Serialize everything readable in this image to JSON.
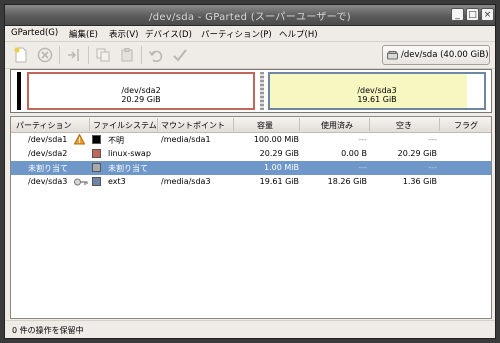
{
  "window": {
    "title": "/dev/sda - GParted (スーパーユーザーで)"
  },
  "menu": [
    "GParted(G)",
    "編集(E)",
    "表示(V)",
    "デバイス(D)",
    "パーティション(P)",
    "ヘルプ(H)"
  ],
  "toolbar": {
    "buttons": [
      "new-icon",
      "delete-icon",
      "resize-move-icon",
      "copy-icon",
      "paste-icon",
      "undo-icon",
      "apply-icon"
    ],
    "device_label": "/dev/sda  (40.00 GiB)"
  },
  "map": {
    "partitions": [
      {
        "name": "",
        "size": "",
        "color": "#000000"
      },
      {
        "name": "/dev/sda2",
        "size": "20.29 GiB",
        "color": "#c1665a"
      },
      {
        "name": "",
        "size": "",
        "color": "#a9a9a9"
      },
      {
        "name": "/dev/sda3",
        "size": "19.61 GiB",
        "color": "#6e86a5",
        "fill": "#f7f7c2"
      }
    ]
  },
  "table": {
    "headers": [
      "パーティション",
      "ファイルシステム",
      "マウントポイント",
      "容量",
      "使用済み",
      "空き",
      "フラグ"
    ],
    "rows": [
      {
        "partition": "/dev/sda1",
        "warn": true,
        "fs_color": "#000000",
        "fs": "不明",
        "mount": "/media/sda1",
        "size": "100.00 MiB",
        "used": "---",
        "free": "---",
        "flags": ""
      },
      {
        "partition": "/dev/sda2",
        "warn": false,
        "fs_color": "#c1665a",
        "fs": "linux-swap",
        "mount": "",
        "size": "20.29 GiB",
        "used": "0.00 B",
        "free": "20.29 GiB",
        "flags": ""
      },
      {
        "partition": "未割り当て",
        "warn": false,
        "fs_color": "#a9a9a9",
        "fs": "未割り当て",
        "mount": "",
        "size": "1.00 MiB",
        "used": "---",
        "free": "---",
        "flags": "",
        "selected": true
      },
      {
        "partition": "/dev/sda3",
        "warn": false,
        "key": true,
        "fs_color": "#6e86a5",
        "fs": "ext3",
        "mount": "/media/sda3",
        "size": "19.61 GiB",
        "used": "18.26 GiB",
        "free": "1.36 GiB",
        "flags": ""
      }
    ]
  },
  "status": "0 件の操作を保留中"
}
